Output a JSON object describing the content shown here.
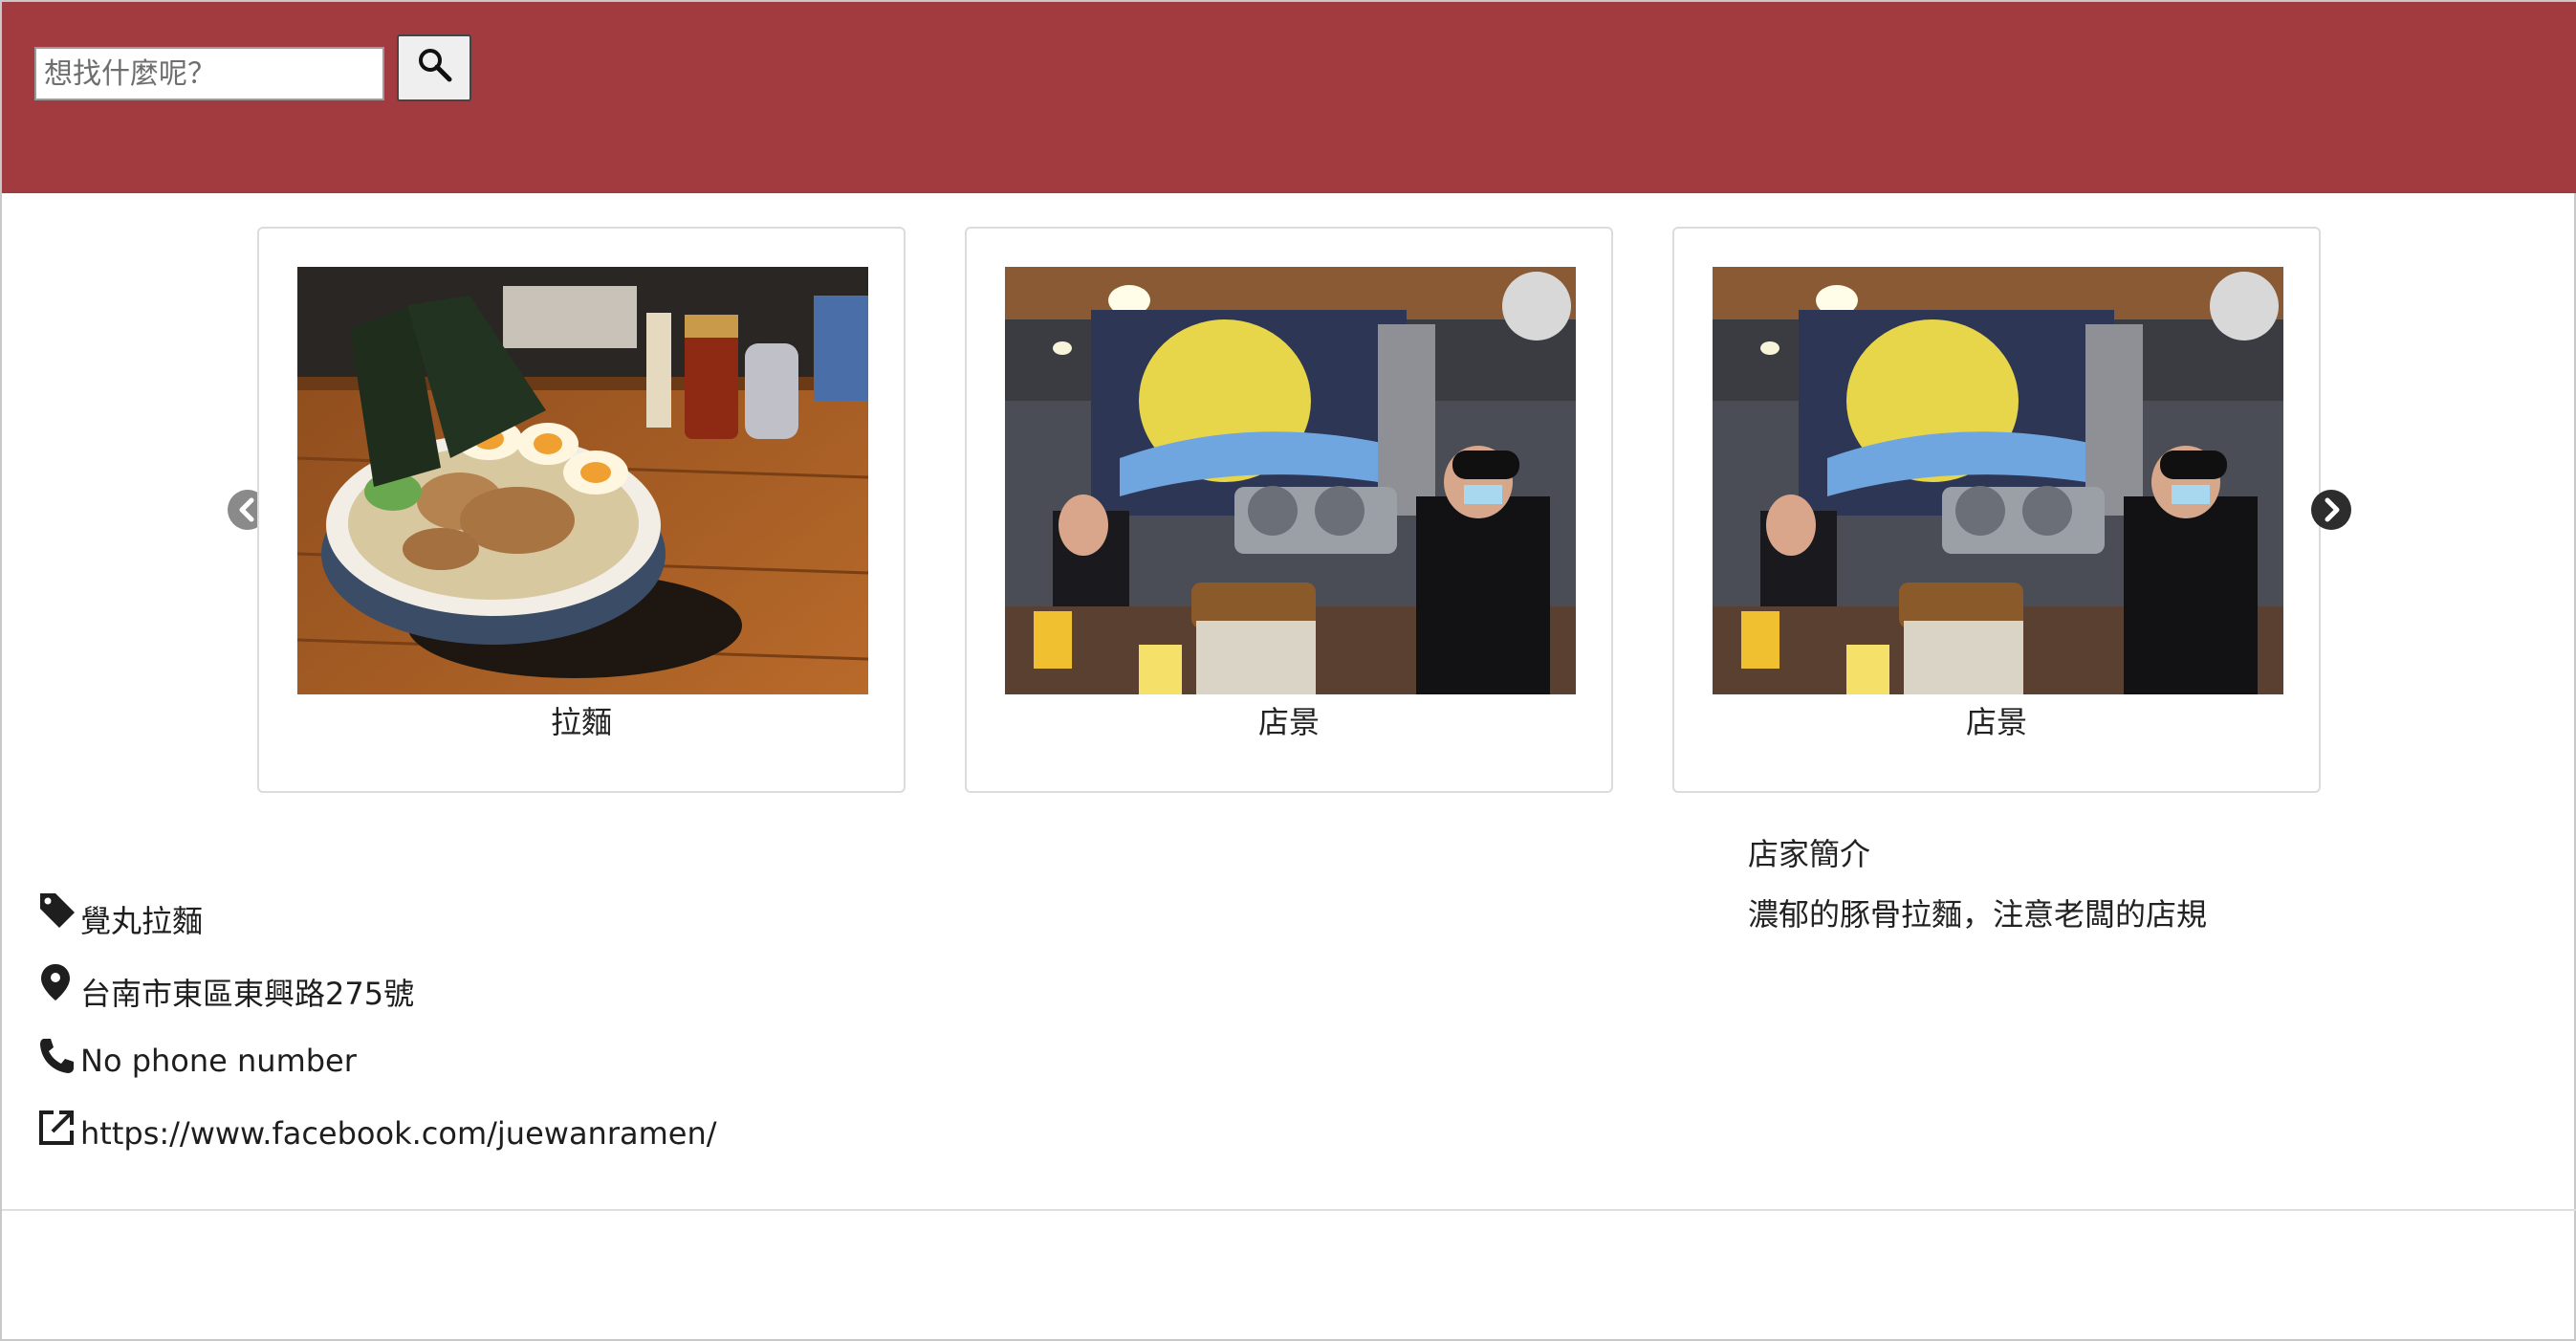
{
  "search": {
    "placeholder": "想找什麼呢？",
    "value": "",
    "button_icon": "search-icon"
  },
  "colors": {
    "header": "#a23b3f",
    "card_border": "#dcdcdc"
  },
  "carousel": {
    "prev_icon": "chevron-left-icon",
    "next_icon": "chevron-right-icon",
    "cards": [
      {
        "caption": "拉麵",
        "image": "ramen-bowl-photo"
      },
      {
        "caption": "店景",
        "image": "shop-interior-photo"
      },
      {
        "caption": "店景",
        "image": "shop-interior-photo"
      }
    ]
  },
  "store": {
    "name": "覺丸拉麵",
    "address": "台南市東區東興路275號",
    "phone": "No phone number",
    "website": "https://www.facebook.com/juewanramen/",
    "icons": {
      "name": "tag-icon",
      "address": "location-pin-icon",
      "phone": "phone-icon",
      "website": "external-link-icon"
    }
  },
  "intro": {
    "title": "店家簡介",
    "body": "濃郁的豚骨拉麵，注意老闆的店規"
  }
}
